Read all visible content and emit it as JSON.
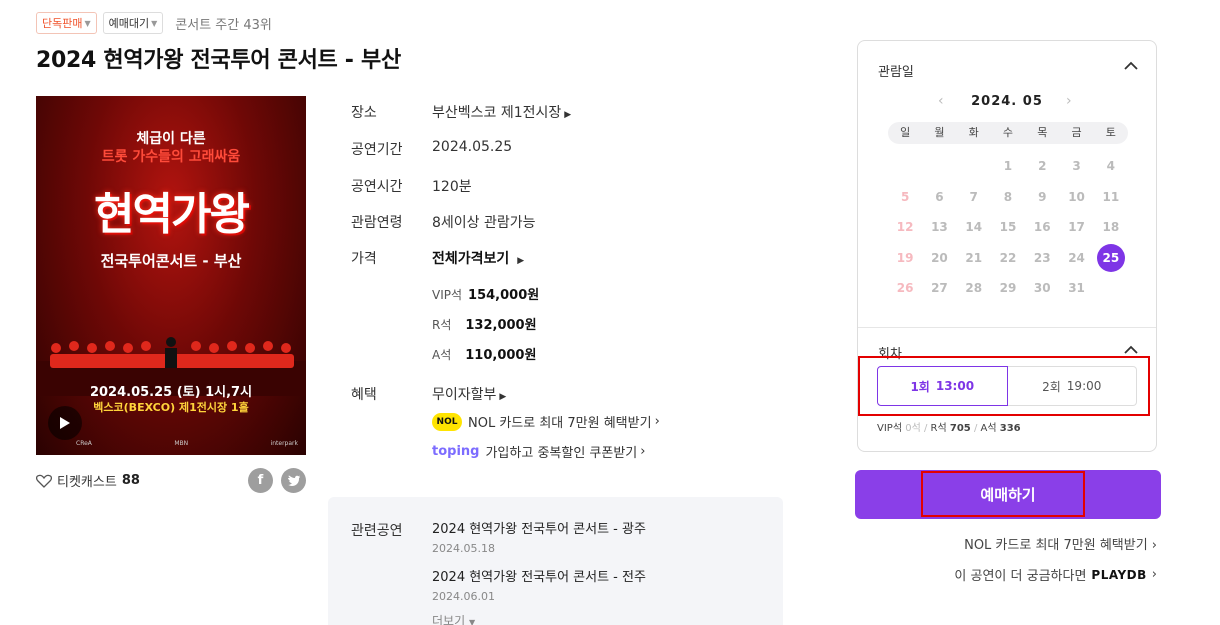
{
  "tags": {
    "exclusive": "단독판매",
    "presale": "예매대기",
    "rank": "콘서트 주간 43위"
  },
  "title": "2024 현역가왕 전국투어 콘서트 - 부산",
  "poster": {
    "tagline1": "체급이 다른",
    "tagline2": "트롯 가수들의 고래싸움",
    "main": "현역가왕",
    "sub": "전국투어콘서트 - 부산",
    "date": "2024.05.25 (토) 1시,7시",
    "venue": "벡스코(BEXCO) 제1전시장 1홀",
    "sponsors": [
      "CReA",
      "MBN",
      "interpark"
    ]
  },
  "ticketcast": {
    "label": "티켓캐스트",
    "count": "88"
  },
  "info": {
    "venue_key": "장소",
    "venue_val": "부산벡스코 제1전시장",
    "period_key": "공연기간",
    "period_val": "2024.05.25",
    "time_key": "공연시간",
    "time_val": "120분",
    "age_key": "관람연령",
    "age_val": "8세이상 관람가능",
    "price_key": "가격",
    "price_all": "전체가격보기",
    "prices": [
      {
        "grade": "VIP석",
        "amount": "154,000원"
      },
      {
        "grade": "R석",
        "amount": "132,000원"
      },
      {
        "grade": "A석",
        "amount": "110,000원"
      }
    ],
    "benefit_key": "혜택",
    "benefit_val": "무이자할부",
    "nol_text": "NOL 카드로 최대 7만원 혜택받기",
    "toping_text": "가입하고 중복할인 쿠폰받기"
  },
  "related": {
    "key": "관련공연",
    "items": [
      {
        "title": "2024 현역가왕 전국투어 콘서트 - 광주",
        "date": "2024.05.18"
      },
      {
        "title": "2024 현역가왕 전국투어 콘서트 - 전주",
        "date": "2024.06.01"
      }
    ],
    "more": "더보기"
  },
  "calendar": {
    "heading": "관람일",
    "month": "2024. 05",
    "weekdays": [
      "일",
      "월",
      "화",
      "수",
      "목",
      "금",
      "토"
    ],
    "weeks": [
      [
        "",
        "",
        "",
        "1",
        "2",
        "3",
        "4"
      ],
      [
        "5",
        "6",
        "7",
        "8",
        "9",
        "10",
        "11"
      ],
      [
        "12",
        "13",
        "14",
        "15",
        "16",
        "17",
        "18"
      ],
      [
        "19",
        "20",
        "21",
        "22",
        "23",
        "24",
        "25"
      ],
      [
        "26",
        "27",
        "28",
        "29",
        "30",
        "31",
        ""
      ]
    ],
    "selected": "25"
  },
  "rounds": {
    "heading": "회차",
    "r1_no": "1회",
    "r1_time": "13:00",
    "r2_no": "2회",
    "r2_time": "19:00",
    "vip": "VIP석",
    "vip_n": "0석",
    "r": "R석",
    "r_n": "705",
    "a": "A석",
    "a_n": "336"
  },
  "book_label": "예매하기",
  "links": {
    "nol": "NOL 카드로 최대 7만원 혜택받기",
    "more_info": "이 공연이 더 궁금하다면",
    "playdb": "PLAYDB"
  },
  "colors": {
    "accent": "#8a3fe8",
    "selected": "#7e35e6",
    "highlight": "#e30000"
  }
}
